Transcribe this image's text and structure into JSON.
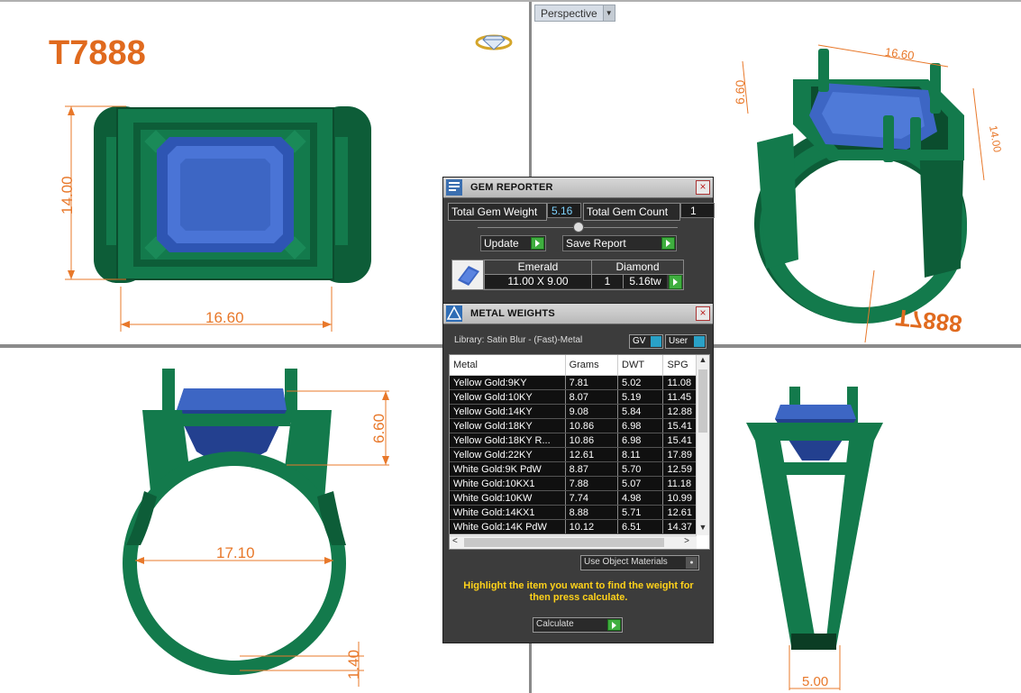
{
  "viewport_label": "Perspective",
  "model_code": "T7888",
  "model_code_mirrored": "T7888",
  "dimensions": {
    "top_width": "16.60",
    "top_height": "14.00",
    "persp_length": "16.60",
    "persp_height": "6.60",
    "persp_depth": "14.00",
    "front_height": "6.60",
    "front_inner": "17.10",
    "front_shank": "1.40",
    "side_width": "5.00"
  },
  "gem_reporter": {
    "title": "GEM REPORTER",
    "total_weight_label": "Total Gem Weight",
    "total_weight_value": "5.16",
    "total_count_label": "Total Gem Count",
    "total_count_value": "1",
    "update_label": "Update",
    "save_report_label": "Save Report",
    "gem_cut": "Emerald",
    "gem_type": "Diamond",
    "gem_size": "11.00 X 9.00",
    "gem_qty": "1",
    "gem_tw": "5.16tw"
  },
  "metal_weights": {
    "title": "METAL WEIGHTS",
    "library": "Library: Satin Blur - (Fast)-Metal",
    "gv_label": "GV",
    "user_label": "User",
    "columns": [
      "Metal",
      "Grams",
      "DWT",
      "SPG"
    ],
    "rows": [
      [
        "Yellow Gold:9KY",
        "7.81",
        "5.02",
        "11.08"
      ],
      [
        "Yellow Gold:10KY",
        "8.07",
        "5.19",
        "11.45"
      ],
      [
        "Yellow Gold:14KY",
        "9.08",
        "5.84",
        "12.88"
      ],
      [
        "Yellow Gold:18KY",
        "10.86",
        "6.98",
        "15.41"
      ],
      [
        "Yellow Gold:18KY R...",
        "10.86",
        "6.98",
        "15.41"
      ],
      [
        "Yellow Gold:22KY",
        "12.61",
        "8.11",
        "17.89"
      ],
      [
        "White Gold:9K PdW",
        "8.87",
        "5.70",
        "12.59"
      ],
      [
        "White Gold:10KX1",
        "7.88",
        "5.07",
        "11.18"
      ],
      [
        "White Gold:10KW",
        "7.74",
        "4.98",
        "10.99"
      ],
      [
        "White Gold:14KX1",
        "8.88",
        "5.71",
        "12.61"
      ],
      [
        "White Gold:14K PdW",
        "10.12",
        "6.51",
        "14.37"
      ]
    ],
    "use_object_materials": "Use Object Materials",
    "hint": "Highlight the item you want to find the weight for then press calculate.",
    "calculate_label": "Calculate"
  },
  "colors": {
    "metal_green": "#137a4c",
    "metal_dark": "#0b4d2e",
    "gem_blue": "#3d66c4",
    "dimension_orange": "#e8782a",
    "panel_bg": "#3c3c3c"
  }
}
